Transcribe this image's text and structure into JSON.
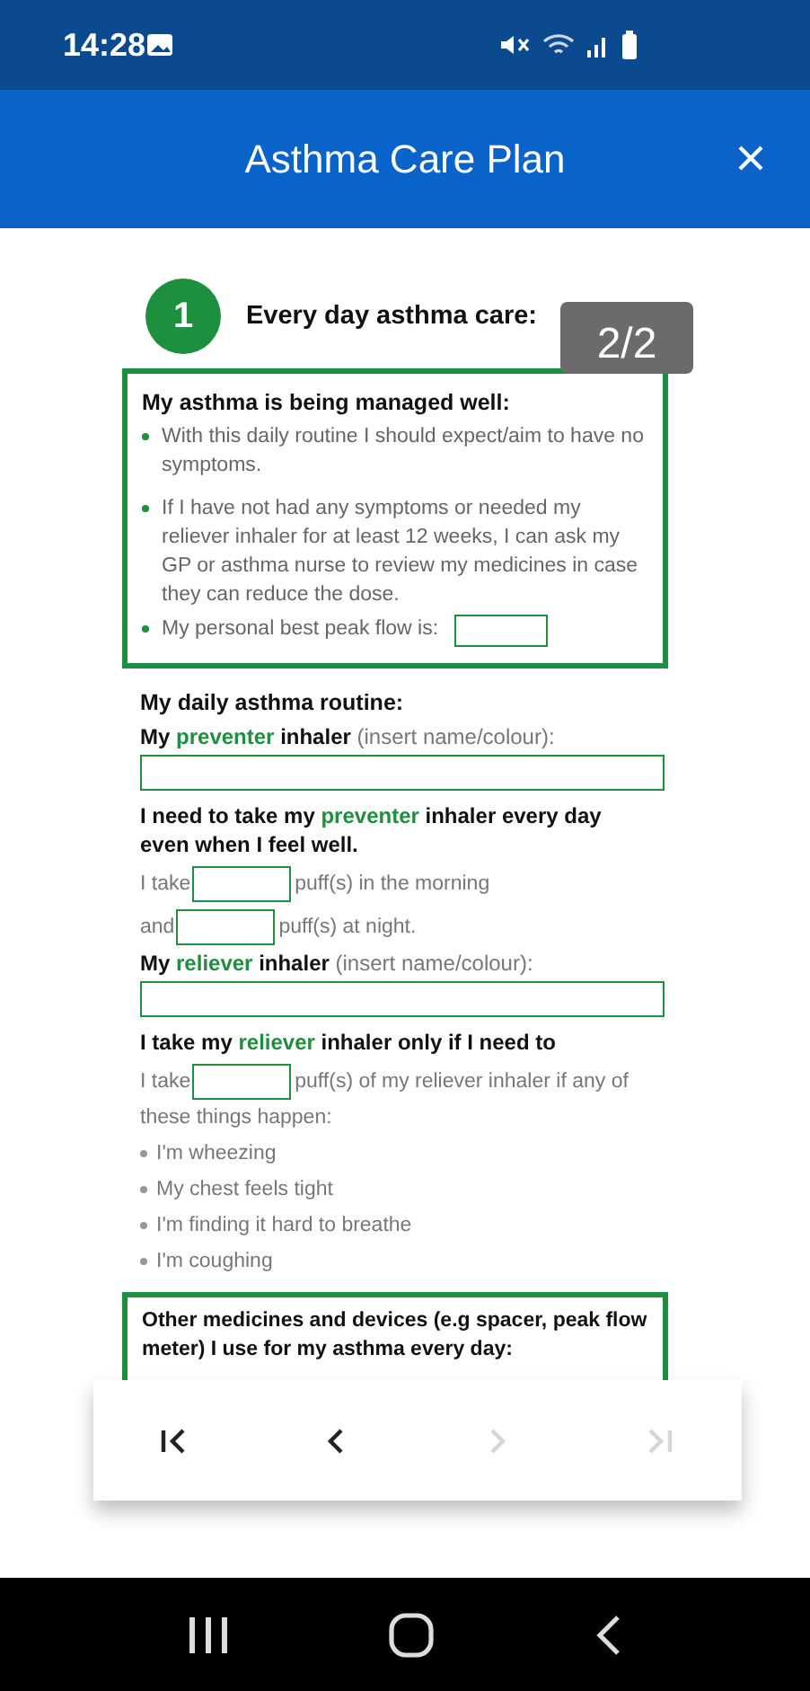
{
  "status_bar": {
    "time": "14:28"
  },
  "app_bar": {
    "title": "Asthma Care Plan"
  },
  "page_indicator": "2/2",
  "document": {
    "section": {
      "number": "1",
      "title": "Every day asthma care:"
    },
    "managed_box": {
      "title": "My asthma is being managed well:",
      "bullets": [
        {
          "text": "With this daily routine I should expect/aim to have no symptoms."
        },
        {
          "text": "If I have not had any symptoms or needed my reliever inhaler for at least 12 weeks, I can ask my GP or asthma nurse to review my medicines in case they can reduce the dose."
        },
        {
          "text": "My personal best peak flow is:",
          "field": true
        }
      ]
    },
    "routine": {
      "heading": "My daily asthma routine:",
      "items": [
        {
          "kind": "label",
          "lead": "My",
          "highlight": "preventer",
          "tail": "inhaler",
          "note": "(insert name/colour):"
        },
        {
          "kind": "field"
        },
        {
          "kind": "label",
          "lead": "I need to take my",
          "highlight": "preventer",
          "tail": "inhaler every day even when I feel well."
        },
        {
          "kind": "dose",
          "before": "I take",
          "after": "puff(s) in the morning"
        },
        {
          "kind": "dose",
          "before": "and",
          "after": "puff(s) at night."
        },
        {
          "kind": "label",
          "lead": "My",
          "highlight": "reliever",
          "tail": "inhaler",
          "note": "(insert name/colour):"
        },
        {
          "kind": "field"
        },
        {
          "kind": "label",
          "lead": "I take my",
          "highlight": "reliever",
          "tail": "inhaler only if I need to"
        },
        {
          "kind": "dose",
          "before": "I take",
          "after": "puff(s) of my reliever inhaler if any of",
          "continuation": "these things happen:"
        },
        {
          "kind": "bullet",
          "text": "I'm wheezing"
        },
        {
          "kind": "bullet",
          "text": "My chest feels tight"
        },
        {
          "kind": "bullet",
          "text": "I'm finding it hard to breathe"
        },
        {
          "kind": "bullet",
          "text": "I'm coughing"
        }
      ]
    },
    "other_box": {
      "title": "Other medicines and devices (e.g spacer, peak flow meter)  I use for my asthma every day:"
    }
  },
  "pager": {
    "buttons": [
      {
        "kind": "first",
        "disabled": false
      },
      {
        "kind": "previous",
        "disabled": false
      },
      {
        "kind": "next",
        "disabled": true
      },
      {
        "kind": "last",
        "disabled": true
      }
    ]
  }
}
